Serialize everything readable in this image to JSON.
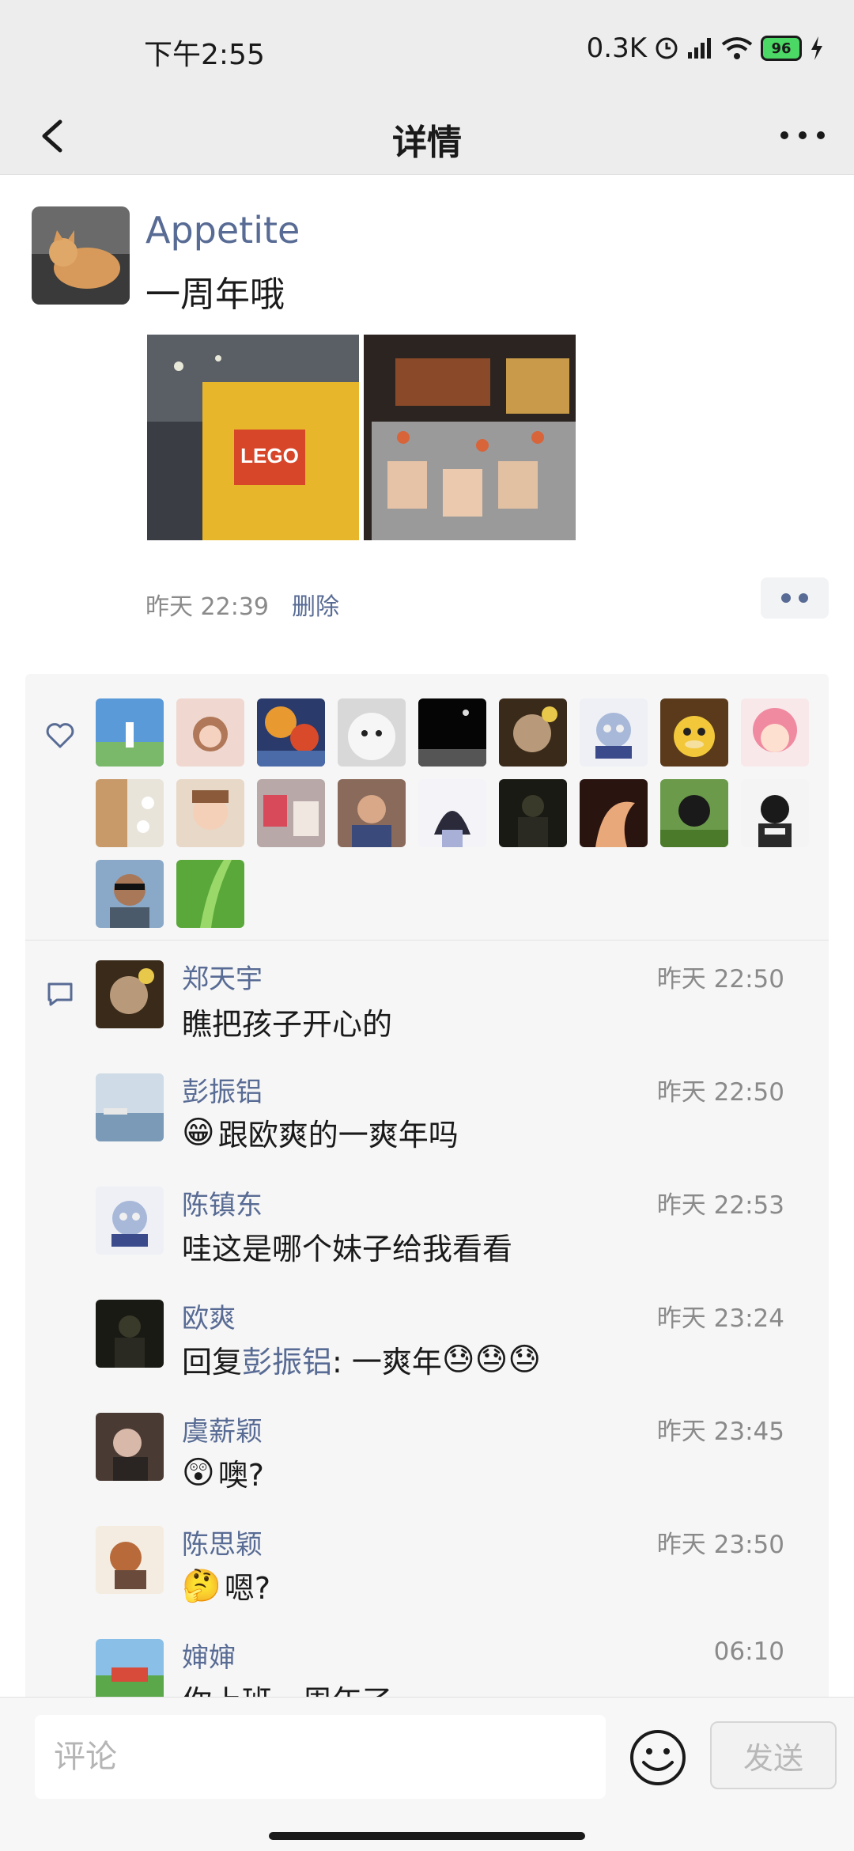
{
  "status": {
    "time": "下午2:55",
    "speed": "0.3K",
    "battery": "96"
  },
  "header": {
    "title": "详情"
  },
  "post": {
    "author": "Appetite",
    "text": "一周年哦",
    "time": "昨天 22:39",
    "delete_label": "删除",
    "images": [
      "lego-bag-photo",
      "barbecue-grill-photo"
    ]
  },
  "likes": {
    "icon": "heart-icon",
    "count_shown": 20
  },
  "comments": [
    {
      "name": "郑天宇",
      "time": "昨天 22:50",
      "text": "瞧把孩子开心的",
      "emoji": ""
    },
    {
      "name": "彭振铝",
      "time": "昨天 22:50",
      "text": "跟欧爽的一爽年吗",
      "emoji": "😁"
    },
    {
      "name": "陈镇东",
      "time": "昨天 22:53",
      "text": "哇这是哪个妹子给我看看",
      "emoji": ""
    },
    {
      "name": "欧爽",
      "time": "昨天 23:24",
      "reply_prefix": "回复",
      "reply_to": "彭振铝",
      "text": ": 一爽年",
      "emoji_after": "😓😓😓"
    },
    {
      "name": "虞薪颖",
      "time": "昨天 23:45",
      "text": " 噢?",
      "emoji": "😲"
    },
    {
      "name": "陈思颖",
      "time": "昨天 23:50",
      "text": " 嗯?",
      "emoji": "🤔"
    },
    {
      "name": "婶婶",
      "time": "06:10",
      "text": "你上班一周年了",
      "emoji": ""
    }
  ],
  "input": {
    "placeholder": "评论",
    "send_label": "发送"
  },
  "colors": {
    "link": "#586b94",
    "meta": "#8a8a8a",
    "bar": "#ededed",
    "panel": "#f6f6f6"
  }
}
